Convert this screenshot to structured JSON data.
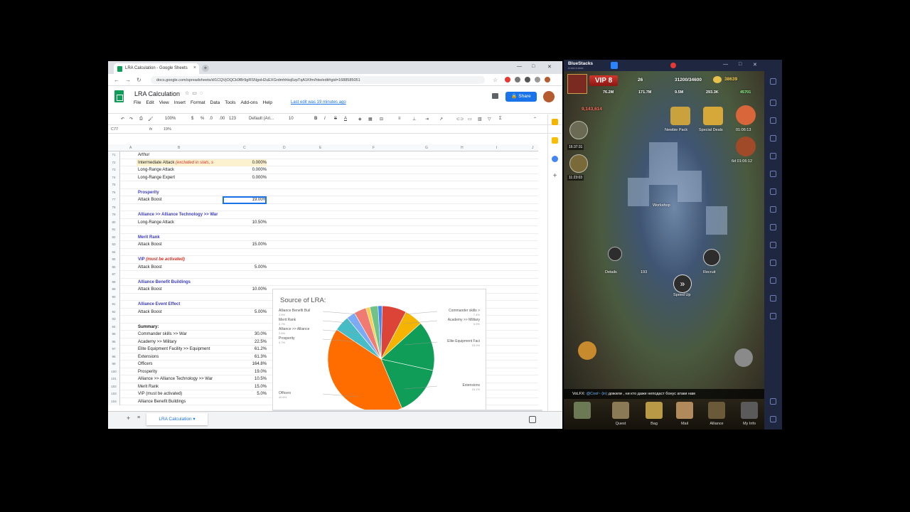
{
  "browser": {
    "tab_title": "LRA Calculation - Google Sheets",
    "tab_close": "×",
    "new_tab": "+",
    "url": "docs.google.com/spreadsheets/d/1CQVjOQCk0f8r9gRSNgoH2uEXGrdmhhkq5zpTqA1Kfm/htw/edit#gid=1688585051",
    "controls": [
      "—",
      "□",
      "✕"
    ]
  },
  "sheets": {
    "title": "LRA Calculation",
    "menus": [
      "File",
      "Edit",
      "View",
      "Insert",
      "Format",
      "Data",
      "Tools",
      "Add-ons",
      "Help"
    ],
    "last_edit": "Last edit was 19 minutes ago",
    "share_label": "Share",
    "toolbar": {
      "zoom": "100%",
      "currency": "$",
      "percent": "%",
      "dec": ".0",
      "dec2": ".00",
      "more": "123",
      "font": "Default (Ari...",
      "size": "10",
      "bold": "B",
      "italic": "I",
      "strike": "S",
      "color": "A"
    },
    "name_box": "C77",
    "fx": "fx",
    "formula_value": "19%",
    "col_headers": [
      "A",
      "B",
      "C",
      "D",
      "E",
      "F",
      "G",
      "H",
      "I",
      "J"
    ],
    "rows": [
      {
        "n": "71",
        "b": "Arthur",
        "c": "",
        "type": "plain"
      },
      {
        "n": "72",
        "b": "Intermediate Attack",
        "note": "(excluded in stats, s",
        "c": "0.000%",
        "type": "hl"
      },
      {
        "n": "73",
        "b": "Long-Range Attack",
        "c": "0.000%",
        "type": "plain"
      },
      {
        "n": "74",
        "b": "Long-Range Expert",
        "c": "0.000%",
        "type": "plain"
      },
      {
        "n": "75",
        "b": "",
        "c": "",
        "type": "plain"
      },
      {
        "n": "76",
        "b": "Prosperity",
        "c": "",
        "type": "head"
      },
      {
        "n": "77",
        "b": "Attack Boost",
        "c": "19.00%",
        "type": "sel"
      },
      {
        "n": "78",
        "b": "",
        "c": "",
        "type": "plain"
      },
      {
        "n": "79",
        "b": "Alliance >> Alliance Technology >> War",
        "c": "",
        "type": "head"
      },
      {
        "n": "80",
        "b": "Long-Range Attack",
        "c": "10.50%",
        "type": "plain"
      },
      {
        "n": "81",
        "b": "",
        "c": "",
        "type": "plain"
      },
      {
        "n": "82",
        "b": "Merit Rank",
        "c": "",
        "type": "head"
      },
      {
        "n": "83",
        "b": "Attack Boost",
        "c": "15.00%",
        "type": "plain"
      },
      {
        "n": "84",
        "b": "",
        "c": "",
        "type": "plain"
      },
      {
        "n": "85",
        "b": "VIP",
        "note": "(must be activated)",
        "c": "",
        "type": "head"
      },
      {
        "n": "86",
        "b": "Attack Boost",
        "c": "5.00%",
        "type": "plain"
      },
      {
        "n": "87",
        "b": "",
        "c": "",
        "type": "plain"
      },
      {
        "n": "88",
        "b": "Alliance Benefit Buildings",
        "c": "",
        "type": "head"
      },
      {
        "n": "89",
        "b": "Attack Boost",
        "c": "10.00%",
        "type": "plain"
      },
      {
        "n": "90",
        "b": "",
        "c": "",
        "type": "plain"
      },
      {
        "n": "91",
        "b": "Alliance Event Effect",
        "c": "",
        "type": "head"
      },
      {
        "n": "92",
        "b": "Attack Boost",
        "c": "5.00%",
        "type": "plain"
      },
      {
        "n": "93",
        "b": "",
        "c": "",
        "type": "plain"
      },
      {
        "n": "94",
        "b": "Summary:",
        "c": "",
        "type": "sum"
      },
      {
        "n": "95",
        "b": "Commander skills >> War",
        "c": "30.0%",
        "type": "plain"
      },
      {
        "n": "96",
        "b": "Academy >> Military",
        "c": "22.5%",
        "type": "plain"
      },
      {
        "n": "97",
        "b": "Elite Equipment Facility >> Equipment",
        "c": "61.2%",
        "type": "plain"
      },
      {
        "n": "98",
        "b": "Extensions",
        "c": "61.3%",
        "type": "plain"
      },
      {
        "n": "99",
        "b": "Officers",
        "c": "164.8%",
        "type": "plain"
      },
      {
        "n": "100",
        "b": "Prosperity",
        "c": "19.0%",
        "type": "plain"
      },
      {
        "n": "101",
        "b": "Alliance >> Alliance Technology >> War",
        "c": "10.5%",
        "type": "plain"
      },
      {
        "n": "102",
        "b": "Merit Rank",
        "c": "15.0%",
        "type": "plain"
      },
      {
        "n": "103",
        "b": "VIP (must be activated)",
        "c": "5.0%",
        "type": "plain"
      },
      {
        "n": "104",
        "b": "Alliance Benefit Buildings",
        "c": "",
        "type": "plain"
      }
    ],
    "chart": {
      "title": "Source of LRA:",
      "labels_left": [
        {
          "name": "Alliance Benefit Buil",
          "pct": "2.5%"
        },
        {
          "name": "Merit Rank",
          "pct": "3.7%"
        },
        {
          "name": "Alliance >> Alliance",
          "pct": "2.6%"
        },
        {
          "name": "Prosperity",
          "pct": "4.7%"
        },
        {
          "name": "Officers",
          "pct": "40.6%"
        }
      ],
      "labels_right": [
        {
          "name": "Commander skills >",
          "pct": "7.4%"
        },
        {
          "name": "Academy >> Military",
          "pct": "5.5%"
        },
        {
          "name": "Elite Equipment Faci",
          "pct": "15.0%"
        },
        {
          "name": "Extensions",
          "pct": "15.1%"
        }
      ]
    },
    "sheet_tab": "LRA Calculation"
  },
  "chart_data": {
    "type": "pie",
    "title": "Source of LRA:",
    "categories": [
      "Commander skills >> War",
      "Academy >> Military",
      "Elite Equipment Facility >> Equipment",
      "Extensions",
      "Officers",
      "Prosperity",
      "Alliance >> Alliance Technology >> War",
      "Merit Rank",
      "VIP (must be activated)",
      "Alliance Benefit Buildings",
      "Alliance Event Effect"
    ],
    "values": [
      30.0,
      22.5,
      61.2,
      61.3,
      164.8,
      19.0,
      10.5,
      15.0,
      5.0,
      10.0,
      5.0
    ],
    "colors": [
      "#db4437",
      "#f4b400",
      "#0f9d58",
      "#0f9d58",
      "#ff6d01",
      "#46bdc6",
      "#7baaf7",
      "#f07b72",
      "#fcd04f",
      "#71c287",
      "#4285f4"
    ]
  },
  "bluestacks": {
    "brand": "BlueStacks",
    "version": "4.xxx.x.xxxx",
    "vip": "VIP 8",
    "level": "26",
    "troops": "31200/34600",
    "gold": "38639",
    "res": [
      "76.2M",
      "171.7M",
      "9.5M",
      "293.3K",
      "45701"
    ],
    "power": "9,143,614",
    "timers": [
      "16:37:31",
      "11:23:03"
    ],
    "offers": [
      "Newbie Pack",
      "Special Deals",
      "01:06:13"
    ],
    "offer_timer2": "6d 01:06:12",
    "center_labels": [
      "Workshop",
      "Speed Up",
      "Recruit",
      "Details"
    ],
    "count": "193",
    "chat_user": "VoLFX:",
    "chat_link": "@Cool~ (in)",
    "chat_text": "дожили , ни кто даже неподаст бонус атаки нам",
    "dock": [
      "Quest",
      "Bag",
      "Mail",
      "Alliance",
      "My Info"
    ]
  }
}
